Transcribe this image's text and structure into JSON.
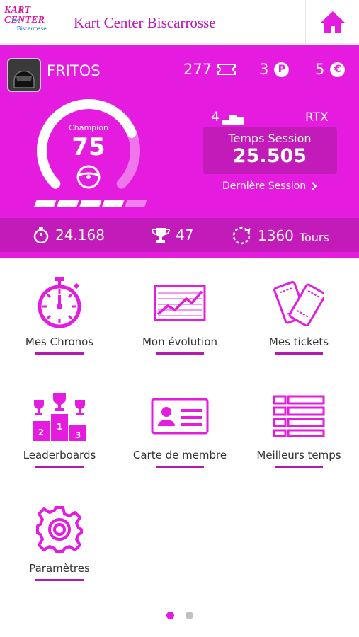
{
  "header": {
    "logo_line1": "KART CENTER",
    "logo_line2": "Biscarrosse",
    "title": "Kart Center Biscarrosse"
  },
  "profile": {
    "username": "FRITOS",
    "tickets": "277",
    "points": "3",
    "points_badge": "P",
    "credits": "5",
    "credits_badge": "€",
    "level_label": "Champion",
    "level_value": "75",
    "level_progress": 0.75,
    "progress_segments_filled": 4,
    "progress_segments_total": 5,
    "rank": "4",
    "kart": "RTX",
    "session_label": "Temps Session",
    "session_value": "25.505",
    "last_session_link": "Dernière Session"
  },
  "stats": {
    "best_lap": "24.168",
    "trophies": "47",
    "laps": "1360",
    "laps_unit": "Tours"
  },
  "menu": [
    {
      "label": "Mes Chronos",
      "icon": "stopwatch-icon"
    },
    {
      "label": "Mon évolution",
      "icon": "chart-icon"
    },
    {
      "label": "Mes tickets",
      "icon": "tickets-icon"
    },
    {
      "label": "Leaderboards",
      "icon": "podium-icon"
    },
    {
      "label": "Carte de membre",
      "icon": "member-card-icon"
    },
    {
      "label": "Meilleurs temps",
      "icon": "list-icon"
    },
    {
      "label": "Paramètres",
      "icon": "gear-icon"
    }
  ],
  "pagination": {
    "current": 1,
    "total": 2
  },
  "colors": {
    "accent": "#e61be0",
    "accent_dark": "#c21bb9",
    "title": "#c312b4"
  }
}
